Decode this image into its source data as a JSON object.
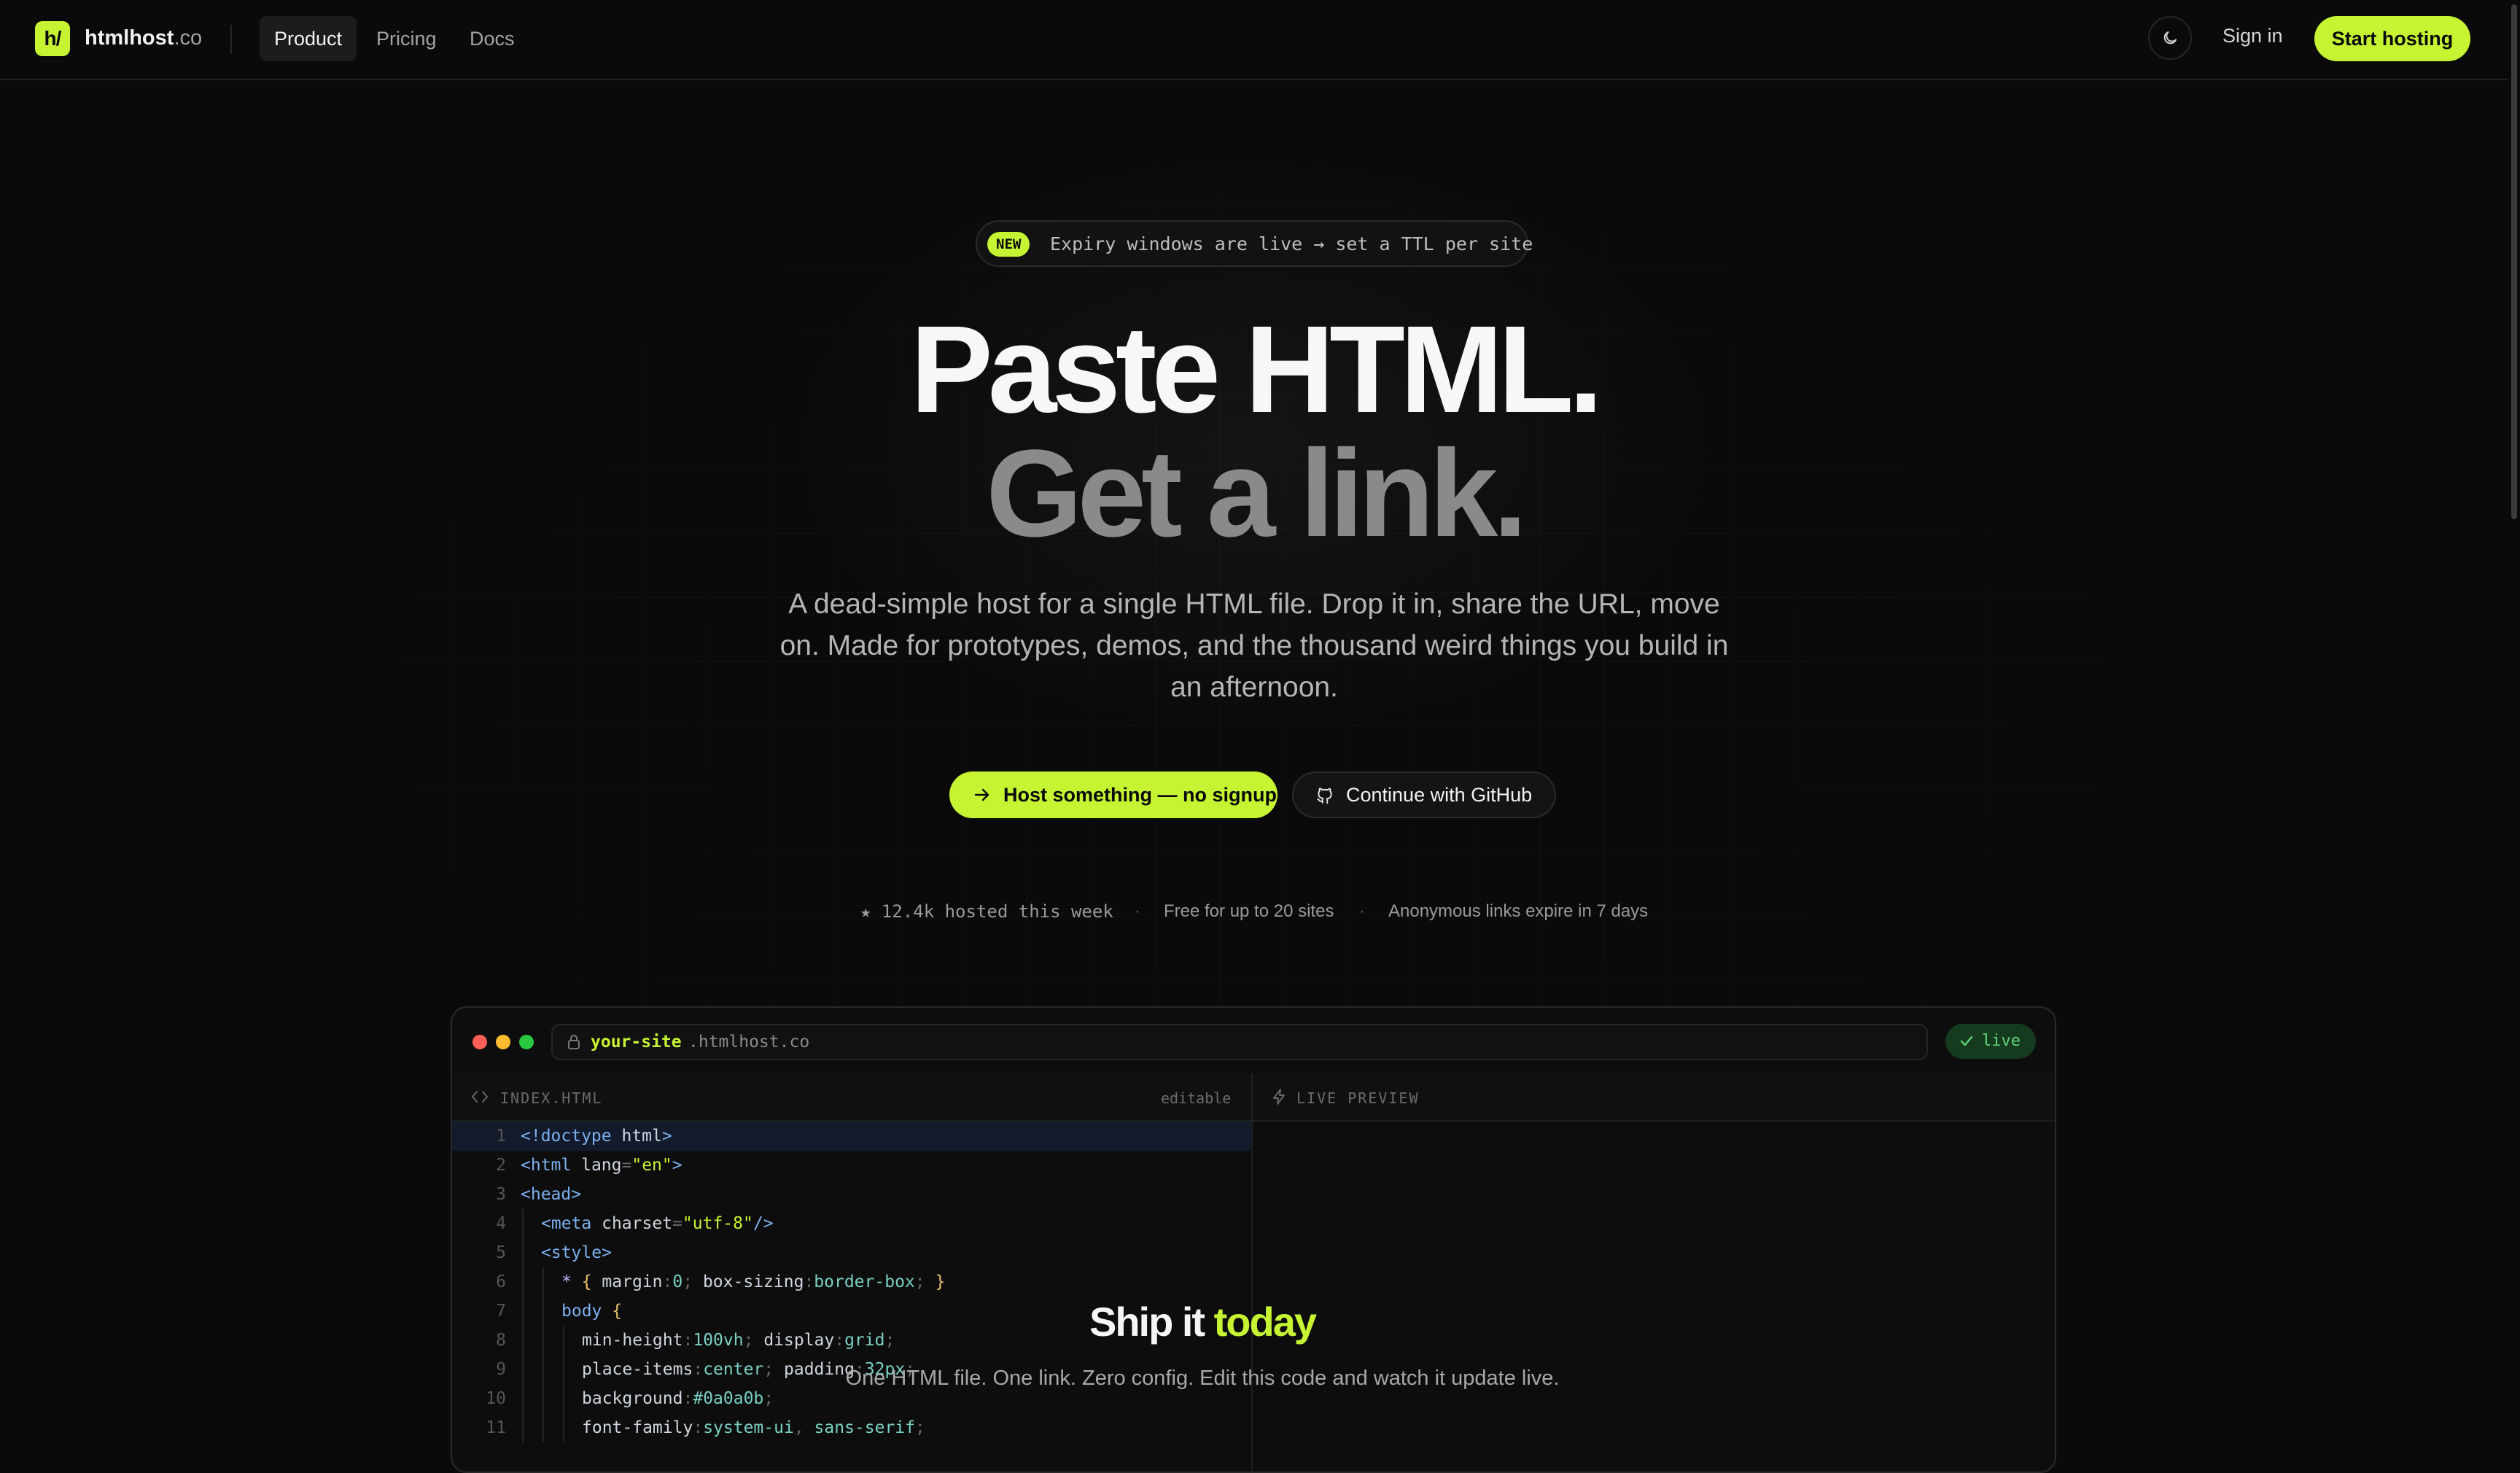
{
  "nav": {
    "logo_mark": "h/",
    "logo_name": "htmlhost",
    "logo_tld": ".co",
    "links": [
      {
        "label": "Product",
        "active": true
      },
      {
        "label": "Pricing",
        "active": false
      },
      {
        "label": "Docs",
        "active": false
      }
    ],
    "theme_icon": "moon-icon",
    "sign_in": "Sign in",
    "start": "Start hosting"
  },
  "hero": {
    "badge_tag": "NEW",
    "badge_text": "Expiry windows are live → set a TTL per site",
    "headline_1": "Paste HTML.",
    "headline_2": "Get a link.",
    "subtitle": "A dead-simple host for a single HTML file. Drop it in, share the URL, move on. Made for prototypes, demos, and the thousand weird things you build in an afternoon.",
    "cta_primary": "Host something — no signup",
    "cta_secondary": "Continue with GitHub",
    "stats": [
      "★ 12.4k hosted this week",
      "Free for up to 20 sites",
      "Anonymous links expire in 7 days"
    ],
    "stats_separator": "·"
  },
  "editor": {
    "url_sub": "your-site",
    "url_host": ".htmlhost.co",
    "status": "live",
    "file_title": "INDEX.HTML",
    "editable_label": "editable",
    "preview_title": "LIVE PREVIEW",
    "line_numbers": [
      "1",
      "2",
      "3",
      "4",
      "5",
      "6",
      "7",
      "8",
      "9",
      "10",
      "11"
    ],
    "preview": {
      "heading": "Ship it",
      "heading_accent": "today",
      "text": "One HTML file. One link. Zero config. Edit this code and watch it update live."
    }
  },
  "colors": {
    "accent": "#c6f432",
    "background": "#0a0a0a",
    "live_green": "#5fd37a"
  }
}
